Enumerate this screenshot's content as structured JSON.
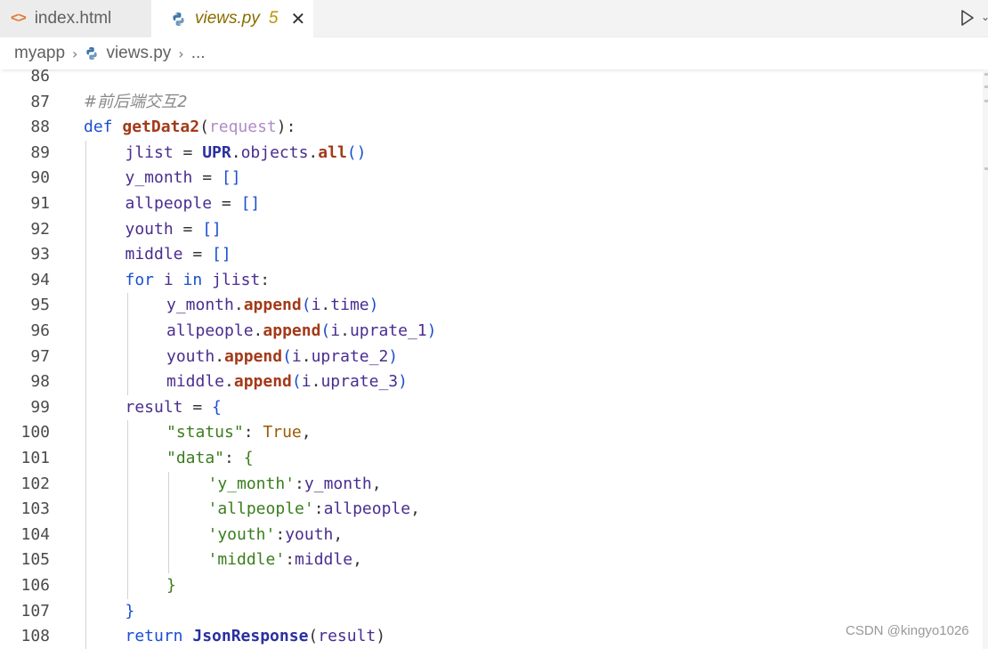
{
  "tabs": [
    {
      "label": "index.html",
      "icon": "html-icon",
      "active": false
    },
    {
      "label": "views.py",
      "icon": "python-icon",
      "active": true,
      "problems": "5"
    }
  ],
  "tab_close_glyph": "✕",
  "toolbar": {
    "run_icon": "run-icon",
    "more_icon": "chevron-down-icon"
  },
  "breadcrumb": {
    "folder": "myapp",
    "file": "views.py",
    "trail": "..."
  },
  "editor": {
    "lines": [
      {
        "num": "86",
        "indent": 0,
        "tokens": []
      },
      {
        "num": "87",
        "indent": 0,
        "tokens": [
          {
            "t": "#前后端交互2",
            "c": "cmt"
          }
        ]
      },
      {
        "num": "88",
        "indent": 0,
        "tokens": [
          {
            "t": "def ",
            "c": "kw"
          },
          {
            "t": "getData2",
            "c": "bold-fn"
          },
          {
            "t": "(",
            "c": "punc"
          },
          {
            "t": "request",
            "c": "param-light"
          },
          {
            "t": "):",
            "c": "punc"
          }
        ]
      },
      {
        "num": "89",
        "indent": 1,
        "tokens": [
          {
            "t": "jlist",
            "c": "var"
          },
          {
            "t": " = ",
            "c": "punc"
          },
          {
            "t": "UPR",
            "c": "cls-bold"
          },
          {
            "t": ".",
            "c": "punc"
          },
          {
            "t": "objects",
            "c": "var"
          },
          {
            "t": ".",
            "c": "punc"
          },
          {
            "t": "all",
            "c": "bold-fn"
          },
          {
            "t": "()",
            "c": "kw"
          }
        ]
      },
      {
        "num": "90",
        "indent": 1,
        "tokens": [
          {
            "t": "y_month",
            "c": "var"
          },
          {
            "t": " = ",
            "c": "punc"
          },
          {
            "t": "[]",
            "c": "kw"
          }
        ]
      },
      {
        "num": "91",
        "indent": 1,
        "tokens": [
          {
            "t": "allpeople",
            "c": "var"
          },
          {
            "t": " = ",
            "c": "punc"
          },
          {
            "t": "[]",
            "c": "kw"
          }
        ]
      },
      {
        "num": "92",
        "indent": 1,
        "tokens": [
          {
            "t": "youth",
            "c": "var"
          },
          {
            "t": " = ",
            "c": "punc"
          },
          {
            "t": "[]",
            "c": "kw"
          }
        ]
      },
      {
        "num": "93",
        "indent": 1,
        "tokens": [
          {
            "t": "middle",
            "c": "var"
          },
          {
            "t": " = ",
            "c": "punc"
          },
          {
            "t": "[]",
            "c": "kw"
          }
        ]
      },
      {
        "num": "94",
        "indent": 1,
        "tokens": [
          {
            "t": "for ",
            "c": "kw"
          },
          {
            "t": "i",
            "c": "var"
          },
          {
            "t": " in ",
            "c": "kw"
          },
          {
            "t": "jlist",
            "c": "var"
          },
          {
            "t": ":",
            "c": "punc"
          }
        ]
      },
      {
        "num": "95",
        "indent": 2,
        "tokens": [
          {
            "t": "y_month",
            "c": "var"
          },
          {
            "t": ".",
            "c": "punc"
          },
          {
            "t": "append",
            "c": "bold-fn"
          },
          {
            "t": "(",
            "c": "kw"
          },
          {
            "t": "i",
            "c": "var"
          },
          {
            "t": ".",
            "c": "punc"
          },
          {
            "t": "time",
            "c": "var"
          },
          {
            "t": ")",
            "c": "kw"
          }
        ]
      },
      {
        "num": "96",
        "indent": 2,
        "tokens": [
          {
            "t": "allpeople",
            "c": "var"
          },
          {
            "t": ".",
            "c": "punc"
          },
          {
            "t": "append",
            "c": "bold-fn"
          },
          {
            "t": "(",
            "c": "kw"
          },
          {
            "t": "i",
            "c": "var"
          },
          {
            "t": ".",
            "c": "punc"
          },
          {
            "t": "uprate_1",
            "c": "var"
          },
          {
            "t": ")",
            "c": "kw"
          }
        ]
      },
      {
        "num": "97",
        "indent": 2,
        "tokens": [
          {
            "t": "youth",
            "c": "var"
          },
          {
            "t": ".",
            "c": "punc"
          },
          {
            "t": "append",
            "c": "bold-fn"
          },
          {
            "t": "(",
            "c": "kw"
          },
          {
            "t": "i",
            "c": "var"
          },
          {
            "t": ".",
            "c": "punc"
          },
          {
            "t": "uprate_2",
            "c": "var"
          },
          {
            "t": ")",
            "c": "kw"
          }
        ]
      },
      {
        "num": "98",
        "indent": 2,
        "tokens": [
          {
            "t": "middle",
            "c": "var"
          },
          {
            "t": ".",
            "c": "punc"
          },
          {
            "t": "append",
            "c": "bold-fn"
          },
          {
            "t": "(",
            "c": "kw"
          },
          {
            "t": "i",
            "c": "var"
          },
          {
            "t": ".",
            "c": "punc"
          },
          {
            "t": "uprate_3",
            "c": "var"
          },
          {
            "t": ")",
            "c": "kw"
          }
        ]
      },
      {
        "num": "99",
        "indent": 1,
        "tokens": [
          {
            "t": "result",
            "c": "var"
          },
          {
            "t": " = ",
            "c": "punc"
          },
          {
            "t": "{",
            "c": "kw"
          }
        ]
      },
      {
        "num": "100",
        "indent": 2,
        "tokens": [
          {
            "t": "\"status\"",
            "c": "str-green"
          },
          {
            "t": ": ",
            "c": "punc"
          },
          {
            "t": "True",
            "c": "true"
          },
          {
            "t": ",",
            "c": "punc"
          }
        ]
      },
      {
        "num": "101",
        "indent": 2,
        "tokens": [
          {
            "t": "\"data\"",
            "c": "str-green"
          },
          {
            "t": ": ",
            "c": "punc"
          },
          {
            "t": "{",
            "c": "brace-green"
          }
        ]
      },
      {
        "num": "102",
        "indent": 3,
        "tokens": [
          {
            "t": "'y_month'",
            "c": "str-green"
          },
          {
            "t": ":",
            "c": "punc"
          },
          {
            "t": "y_month",
            "c": "var"
          },
          {
            "t": ",",
            "c": "punc"
          }
        ]
      },
      {
        "num": "103",
        "indent": 3,
        "tokens": [
          {
            "t": "'allpeople'",
            "c": "str-green"
          },
          {
            "t": ":",
            "c": "punc"
          },
          {
            "t": "allpeople",
            "c": "var"
          },
          {
            "t": ",",
            "c": "punc"
          }
        ]
      },
      {
        "num": "104",
        "indent": 3,
        "tokens": [
          {
            "t": "'youth'",
            "c": "str-green"
          },
          {
            "t": ":",
            "c": "punc"
          },
          {
            "t": "youth",
            "c": "var"
          },
          {
            "t": ",",
            "c": "punc"
          }
        ]
      },
      {
        "num": "105",
        "indent": 3,
        "tokens": [
          {
            "t": "'middle'",
            "c": "str-green"
          },
          {
            "t": ":",
            "c": "punc"
          },
          {
            "t": "middle",
            "c": "var"
          },
          {
            "t": ",",
            "c": "punc"
          }
        ]
      },
      {
        "num": "106",
        "indent": 2,
        "tokens": [
          {
            "t": "}",
            "c": "brace-green"
          }
        ]
      },
      {
        "num": "107",
        "indent": 1,
        "tokens": [
          {
            "t": "}",
            "c": "kw"
          }
        ]
      },
      {
        "num": "108",
        "indent": 1,
        "tokens": [
          {
            "t": "return ",
            "c": "kw"
          },
          {
            "t": "JsonResponse",
            "c": "cls-bold"
          },
          {
            "t": "(",
            "c": "punc"
          },
          {
            "t": "result",
            "c": "var"
          },
          {
            "t": ")",
            "c": "punc"
          }
        ]
      }
    ]
  },
  "watermark": "CSDN @kingyo1026",
  "colors": {
    "keyword": "#1a4fd1",
    "function_bold": "#a33a1a",
    "class_bold": "#2a2fa0",
    "variable": "#4a2d8f",
    "string": "#3a7d1e",
    "true_const": "#9a5a00",
    "comment": "#8a8a8a",
    "line_number": "#4b4b4b",
    "param": "#b08cc8"
  }
}
